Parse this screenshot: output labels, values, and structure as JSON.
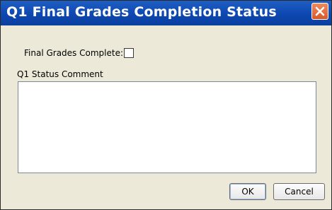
{
  "window": {
    "title": "Q1 Final Grades Completion Status",
    "close_icon": "close-icon"
  },
  "form": {
    "complete_label": "Final Grades Complete:",
    "complete_checked": false,
    "comment_label": "Q1 Status Comment",
    "comment_value": ""
  },
  "buttons": {
    "ok_label": "OK",
    "cancel_label": "Cancel"
  },
  "colors": {
    "titlebar": "#0d47b0",
    "close_button": "#e06a3a",
    "dialog_background": "#ece9d8"
  }
}
